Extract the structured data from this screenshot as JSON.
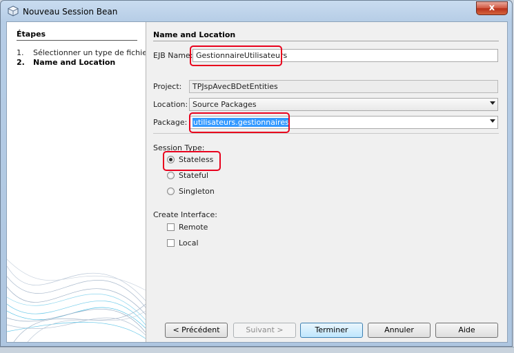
{
  "window": {
    "title": "Nouveau Session Bean",
    "close_label": "x"
  },
  "steps": {
    "title": "Étapes",
    "items": [
      {
        "num": "1.",
        "label": "Sélectionner un type de fichier"
      },
      {
        "num": "2.",
        "label": "Name and Location"
      }
    ]
  },
  "form": {
    "section_title": "Name and Location",
    "ejb_name": {
      "label": "EJB Name:",
      "value": "GestionnaireUtilisateurs"
    },
    "project": {
      "label": "Project:",
      "value": "TPJspAvecBDetEntities"
    },
    "location": {
      "label": "Location:",
      "value": "Source Packages"
    },
    "package": {
      "label": "Package:",
      "value": "utilisateurs.gestionnaires"
    },
    "session_type": {
      "label": "Session Type:",
      "options": [
        "Stateless",
        "Stateful",
        "Singleton"
      ],
      "selected": "Stateless"
    },
    "create_interface": {
      "label": "Create Interface:",
      "options": [
        "Remote",
        "Local"
      ]
    }
  },
  "buttons": {
    "previous": "< Précédent",
    "next": "Suivant >",
    "finish": "Terminer",
    "cancel": "Annuler",
    "help": "Aide"
  },
  "colors": {
    "highlight": "#e8001c",
    "selection": "#3399ff"
  }
}
